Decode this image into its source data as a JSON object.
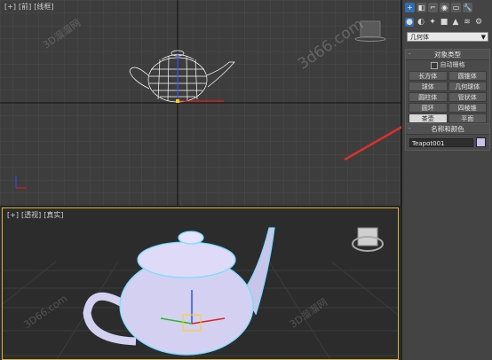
{
  "viewport_front": {
    "labels": [
      "[+]",
      "[前]",
      "[线框]"
    ]
  },
  "viewport_persp": {
    "labels": [
      "[+]",
      "[透视]",
      "[真实]"
    ]
  },
  "panel": {
    "tabs": [
      "+",
      "◧",
      "⌐",
      "◉",
      "▭",
      "🔧"
    ],
    "category_dropdown": "几何体",
    "object_type": {
      "header": "对象类型",
      "autogrid": "自动栅格",
      "buttons": [
        "长方体",
        "圆锥体",
        "球体",
        "几何球体",
        "圆柱体",
        "管状体",
        "圆环",
        "四棱锥",
        "茶壶",
        "平面"
      ]
    },
    "name_color": {
      "header": "名称和颜色",
      "name_value": "Teapot001",
      "swatch_color": "#c6c2ee"
    }
  },
  "watermarks": [
    "3D溜溜网",
    "3d66.com",
    "3D溜溜网",
    "3D66.com"
  ],
  "colors": {
    "accent_tab": "#2f6fb0",
    "viewport_active_border": "#d8b23a",
    "arrow": "#d8322a",
    "teapot": "#d4d0f2"
  }
}
